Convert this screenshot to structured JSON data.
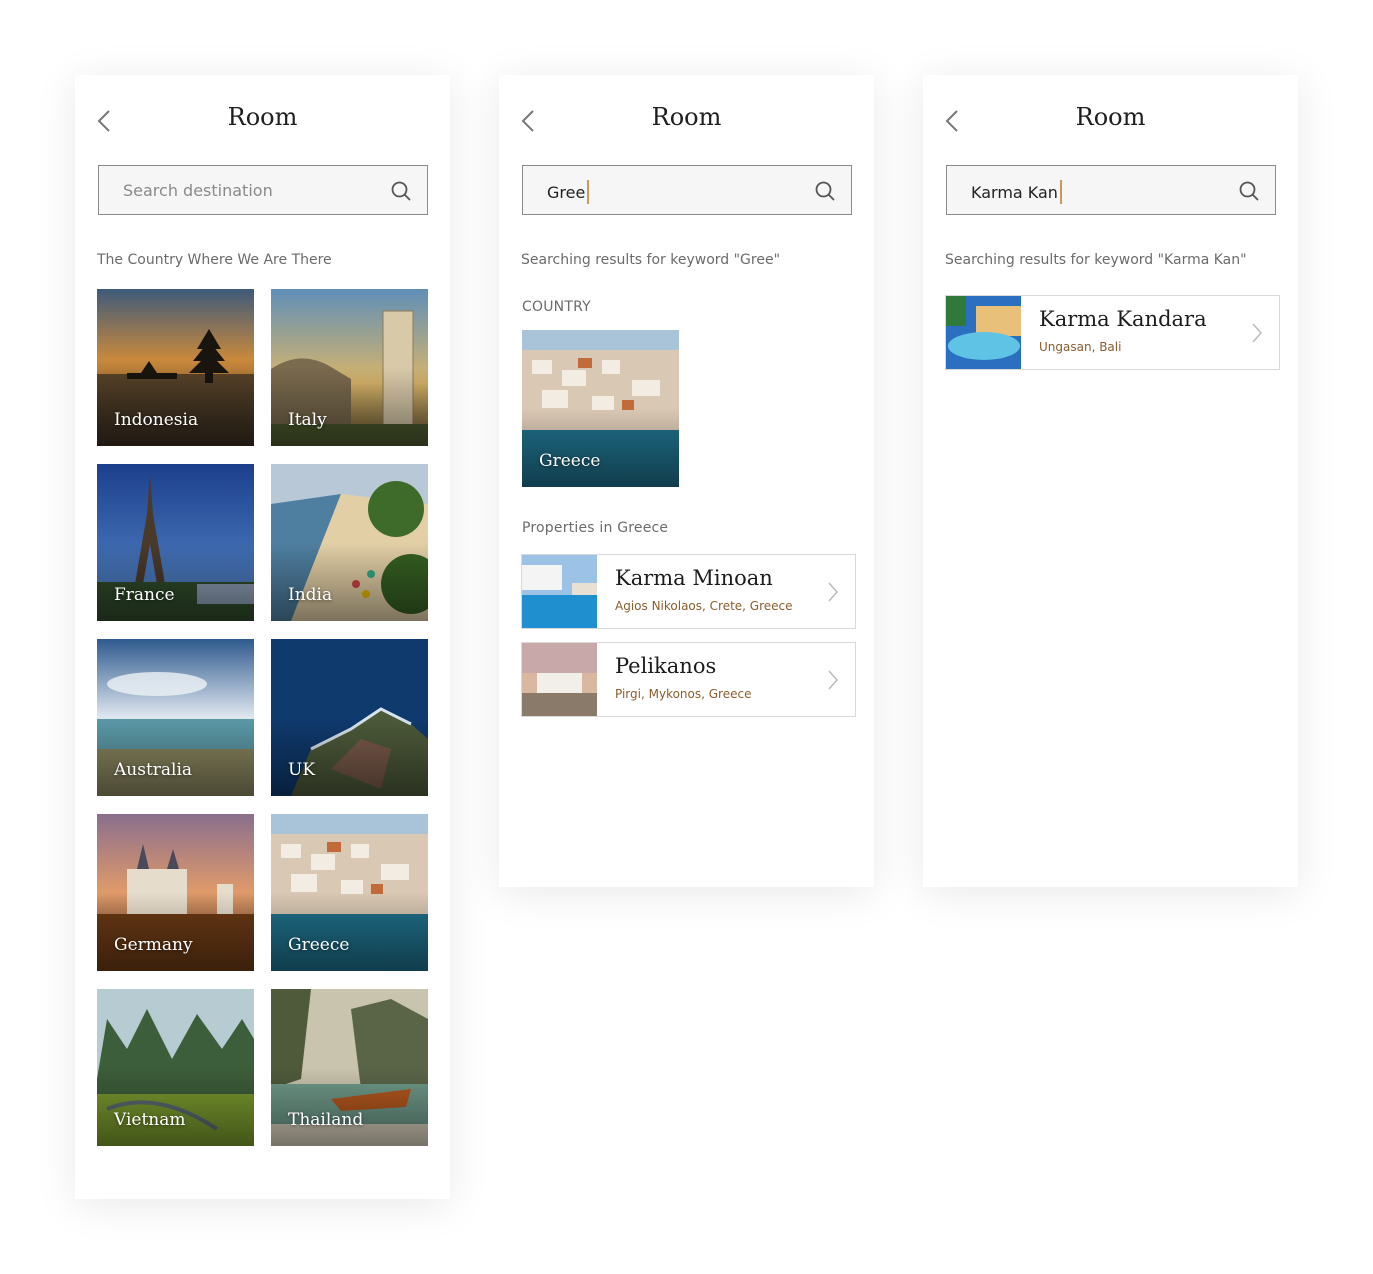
{
  "colors": {
    "caret": "#c79a5b",
    "location_text": "#8a5d2e",
    "card_border": "#d9d9d9"
  },
  "screens": [
    {
      "title": "Room",
      "search": {
        "placeholder": "Search destination",
        "value": ""
      },
      "section_label": "The Country Where We Are There",
      "countries": [
        {
          "name": "Indonesia"
        },
        {
          "name": "Italy"
        },
        {
          "name": "France"
        },
        {
          "name": "India"
        },
        {
          "name": "Australia"
        },
        {
          "name": "UK"
        },
        {
          "name": "Germany"
        },
        {
          "name": "Greece"
        },
        {
          "name": "Vietnam"
        },
        {
          "name": "Thailand"
        }
      ]
    },
    {
      "title": "Room",
      "search": {
        "value": "Gree"
      },
      "results_text": "Searching results for keyword \"Gree\"",
      "country_heading": "COUNTRY",
      "country_result": {
        "name": "Greece"
      },
      "properties_heading": "Properties in Greece",
      "properties": [
        {
          "name": "Karma Minoan",
          "location": "Agios Nikolaos, Crete, Greece"
        },
        {
          "name": "Pelikanos",
          "location": "Pirgi, Mykonos, Greece"
        }
      ]
    },
    {
      "title": "Room",
      "search": {
        "value": "Karma Kan"
      },
      "results_text": "Searching results for keyword \"Karma Kan\"",
      "properties": [
        {
          "name": "Karma Kandara",
          "location": "Ungasan, Bali"
        }
      ]
    }
  ]
}
